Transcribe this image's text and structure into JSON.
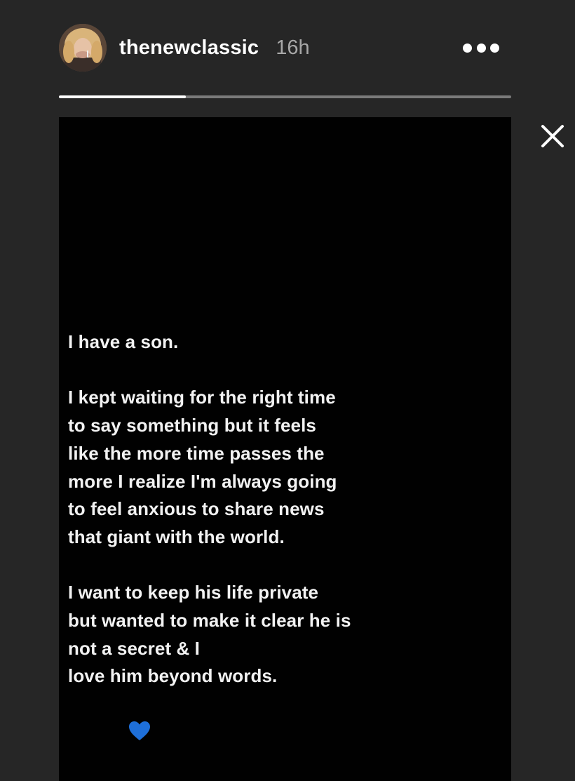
{
  "story": {
    "username": "thenewclassic",
    "timestamp": "16h",
    "progress": 0.28,
    "paragraphs": [
      [
        "I have a son."
      ],
      [
        "I kept waiting for the right time",
        "to say something but it feels",
        "like the more time passes the",
        "more I realize I'm always going",
        "to feel anxious to share news",
        "that giant with the world."
      ],
      [
        "I want to keep his life private",
        "but wanted to make it clear he is",
        "not a secret & I",
        "love him beyond words."
      ]
    ],
    "emoji": "blue-heart",
    "emoji_color": "#1e6fd9"
  },
  "icons": {
    "more": "more-options-icon",
    "close": "close-icon"
  },
  "colors": {
    "background": "#262626",
    "card": "#010101",
    "text": "#f2f2f2",
    "timestamp": "#a8a8a8",
    "progress_track": "#7a7a7a",
    "progress_fill": "#ffffff"
  }
}
